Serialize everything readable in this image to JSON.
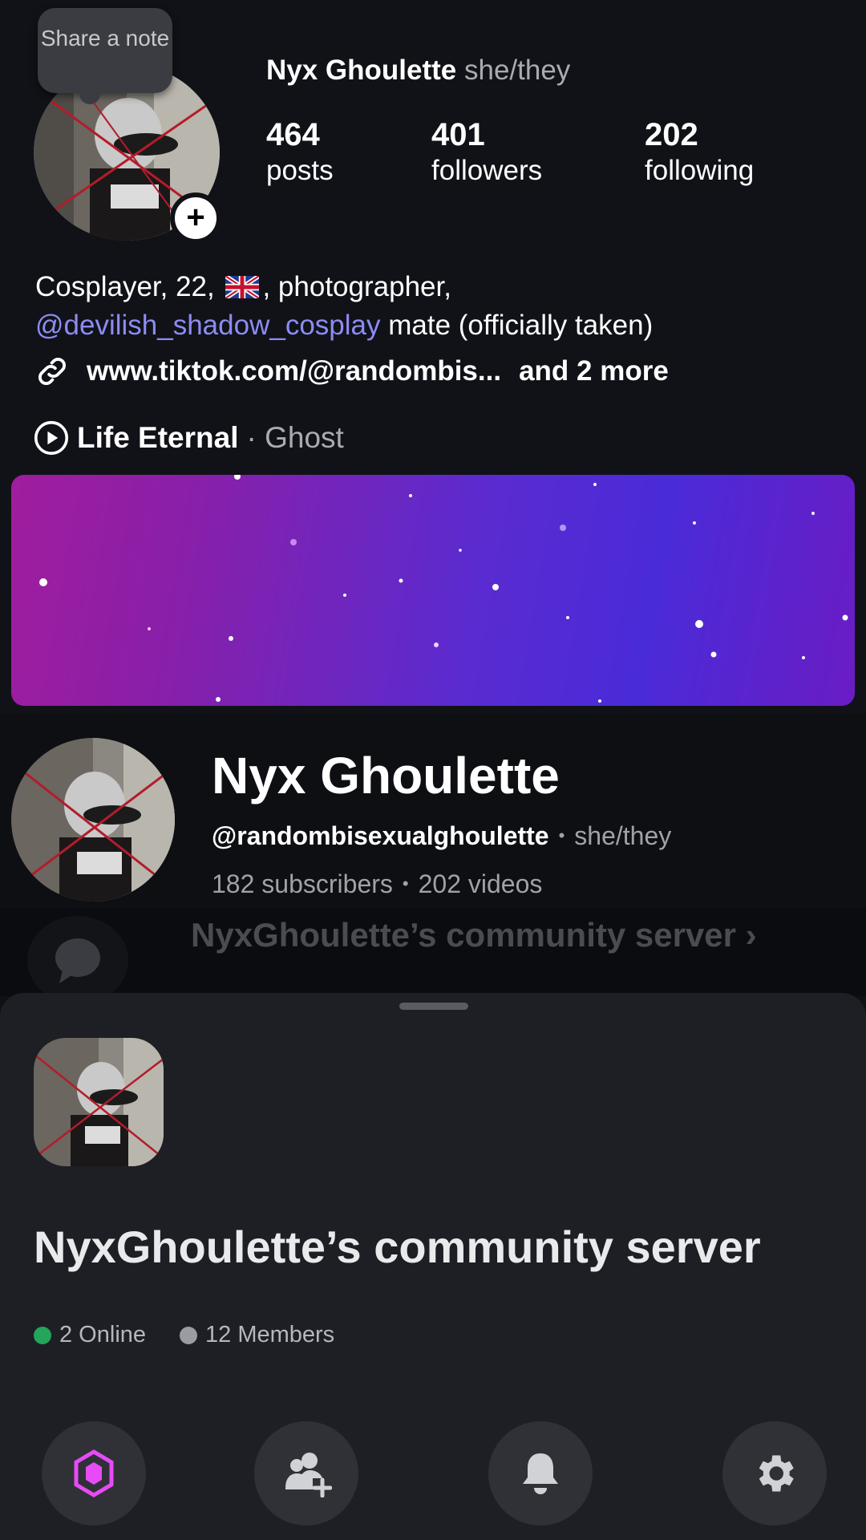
{
  "instagram": {
    "note_label": "Share a note",
    "display_name": "Nyx Ghoulette",
    "pronouns": "she/they",
    "stats": [
      {
        "value": "464",
        "label": "posts"
      },
      {
        "value": "401",
        "label": "followers"
      },
      {
        "value": "202",
        "label": "following"
      }
    ],
    "bio_line1_pre": "Cosplayer, 22,",
    "bio_line1_post": ", photographer,",
    "bio_mention": "@devilish_shadow_cosplay",
    "bio_line2_post": " mate (officially taken)",
    "link_text": "www.tiktok.com/@randombis...",
    "link_more": "and 2 more",
    "song_title": "Life Eternal",
    "song_artist": "· Ghost"
  },
  "youtube": {
    "channel_name": "Nyx Ghoulette",
    "handle": "@randombisexualghoulette",
    "pronouns": "she/they",
    "subscribers": "182 subscribers",
    "videos": "202 videos"
  },
  "discord": {
    "dim_title": "NyxGhoulette’s community server ›",
    "server_name": "NyxGhoulette’s community server",
    "online": "2 Online",
    "members": "12 Members",
    "colors": {
      "online": "#23a55a",
      "members": "#9a9ca2",
      "boost": "#e64bf5"
    }
  },
  "icons": [
    "link-icon",
    "play-circle-icon",
    "chat-bubble-icon",
    "nitro-boost-icon",
    "add-friend-icon",
    "bell-icon",
    "gear-icon",
    "uk-flag-icon"
  ]
}
